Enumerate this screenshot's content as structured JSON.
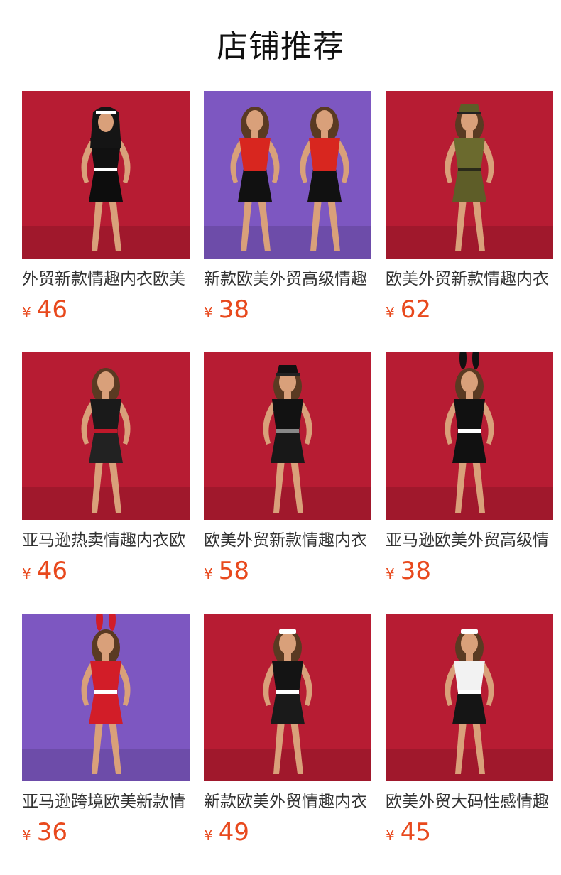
{
  "page": {
    "title": "店铺推荐"
  },
  "colors": {
    "price": "#e8491d",
    "title_text": "#333333",
    "heading_text": "#111111"
  },
  "products": [
    {
      "title": "外贸新款情趣内衣欧美",
      "currency": "¥",
      "price": "46",
      "bg": "#b71c33",
      "costume": "nun"
    },
    {
      "title": "新款欧美外贸高级情趣",
      "currency": "¥",
      "price": "38",
      "bg": "#7d57c1",
      "costume": "red-mesh-duo"
    },
    {
      "title": "欧美外贸新款情趣内衣",
      "currency": "¥",
      "price": "62",
      "bg": "#b71c33",
      "costume": "military"
    },
    {
      "title": "亚马逊热卖情趣内衣欧",
      "currency": "¥",
      "price": "46",
      "bg": "#b71c33",
      "costume": "teacher"
    },
    {
      "title": "欧美外贸新款情趣内衣",
      "currency": "¥",
      "price": "58",
      "bg": "#b71c33",
      "costume": "police"
    },
    {
      "title": "亚马逊欧美外贸高级情",
      "currency": "¥",
      "price": "38",
      "bg": "#b71c33",
      "costume": "bunny-black"
    },
    {
      "title": "亚马逊跨境欧美新款情",
      "currency": "¥",
      "price": "36",
      "bg": "#7d57c1",
      "costume": "bunny-red"
    },
    {
      "title": "新款欧美外贸情趣内衣",
      "currency": "¥",
      "price": "49",
      "bg": "#b71c33",
      "costume": "maid-black"
    },
    {
      "title": "欧美外贸大码性感情趣",
      "currency": "¥",
      "price": "45",
      "bg": "#b71c33",
      "costume": "maid-white"
    }
  ]
}
